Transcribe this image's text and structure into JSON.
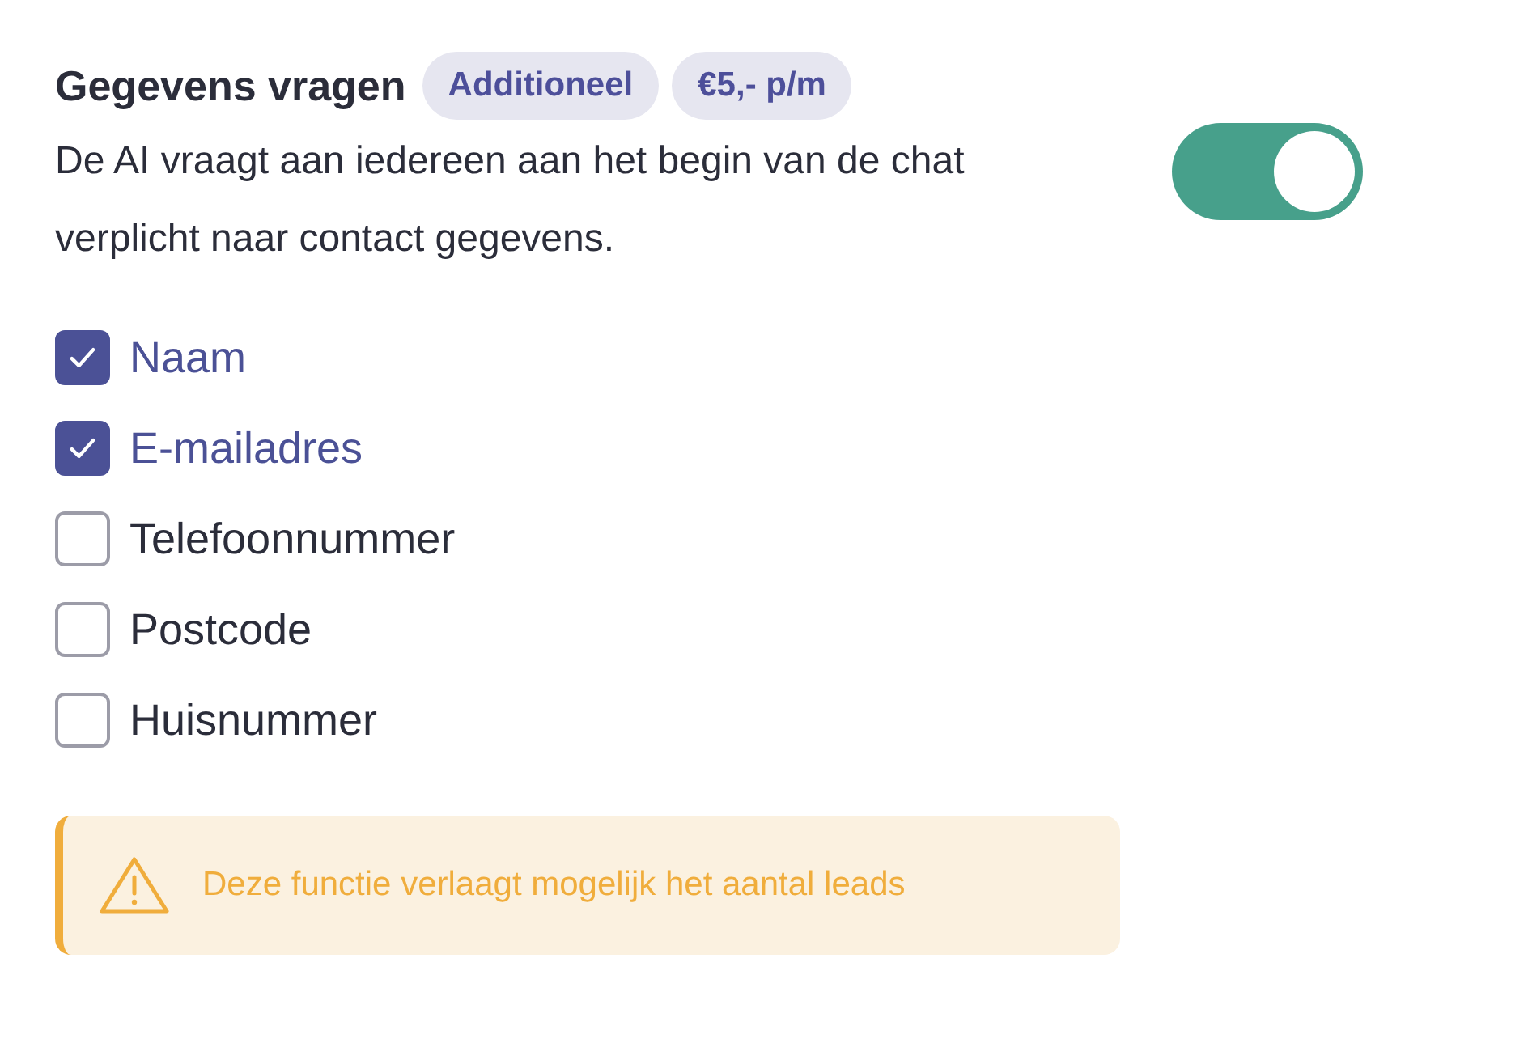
{
  "title": "Gegevens vragen",
  "badges": [
    "Additioneel",
    "€5,- p/m"
  ],
  "description": "De AI vraagt aan iedereen aan het begin van de chat verplicht naar contact gegevens.",
  "toggle": {
    "on": true
  },
  "fields": [
    {
      "label": "Naam",
      "checked": true
    },
    {
      "label": "E-mailadres",
      "checked": true
    },
    {
      "label": "Telefoonnummer",
      "checked": false
    },
    {
      "label": "Postcode",
      "checked": false
    },
    {
      "label": "Huisnummer",
      "checked": false
    }
  ],
  "warning": {
    "text": "Deze functie verlaagt mogelijk het aantal leads"
  }
}
